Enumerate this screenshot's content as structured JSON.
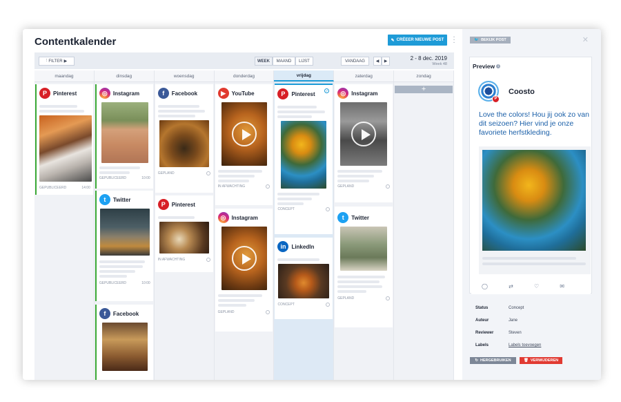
{
  "header": {
    "title": "Contentkalender",
    "new_post_label": "CRËEER NIEUWE POST"
  },
  "toolbar": {
    "filter_label": "FILTER",
    "views": [
      "WEEK",
      "MAAND",
      "LIJST"
    ],
    "active_view": "WEEK",
    "today_label": "VANDAAG",
    "date_range": "2 - 8 dec. 2019",
    "week": "Week 48"
  },
  "days": [
    "maandag",
    "dinsdag",
    "woensdag",
    "donderdag",
    "vrijdag",
    "zaterdag",
    "zondag"
  ],
  "today": "vrijdag",
  "columns": {
    "maandag": [
      {
        "network": "Pinterest",
        "status": "GEPUBLICEERD",
        "time": "14:00"
      }
    ],
    "dinsdag": [
      {
        "network": "Instagram",
        "status": "GEPUBLICEERD",
        "time": "10:00"
      },
      {
        "network": "Twitter",
        "status": "GEPUBLICEERD",
        "time": "10:00"
      },
      {
        "network": "Facebook"
      }
    ],
    "woensdag": [
      {
        "network": "Facebook",
        "status": "GEPLAND"
      },
      {
        "network": "Pinterest",
        "status": "IN AFWACHTING"
      }
    ],
    "donderdag": [
      {
        "network": "YouTube",
        "status": "IN AFWACHTING"
      },
      {
        "network": "Instagram",
        "status": "GEPLAND"
      }
    ],
    "vrijdag": [
      {
        "network": "Pinterest",
        "status": "CONCEPT"
      },
      {
        "network": "LinkedIn",
        "status": "CONCEPT"
      }
    ],
    "zaterdag": [
      {
        "network": "Instagram",
        "status": "GEPLAND"
      },
      {
        "network": "Twitter",
        "status": "GEPLAND"
      }
    ]
  },
  "panel": {
    "badge_label": "BEKIJK POST",
    "preview_title": "Preview",
    "account_name": "Coosto",
    "tweet_text": "Love the colors! Hou jij ook zo van dit seizoen? Hier vind je onze favoriete herfstkleding.",
    "meta": [
      {
        "key": "Status",
        "value": "Concept"
      },
      {
        "key": "Auteur",
        "value": "Jane"
      },
      {
        "key": "Reviewer",
        "value": "Steven"
      },
      {
        "key": "Labels",
        "value": "Labels toevoegen"
      }
    ],
    "reuse_label": "HERGEBRUIKEN",
    "delete_label": "VERWIJDEREN"
  },
  "colors": {
    "accent": "#1e9bd7",
    "published": "#3aa935",
    "danger": "#e13a32"
  }
}
